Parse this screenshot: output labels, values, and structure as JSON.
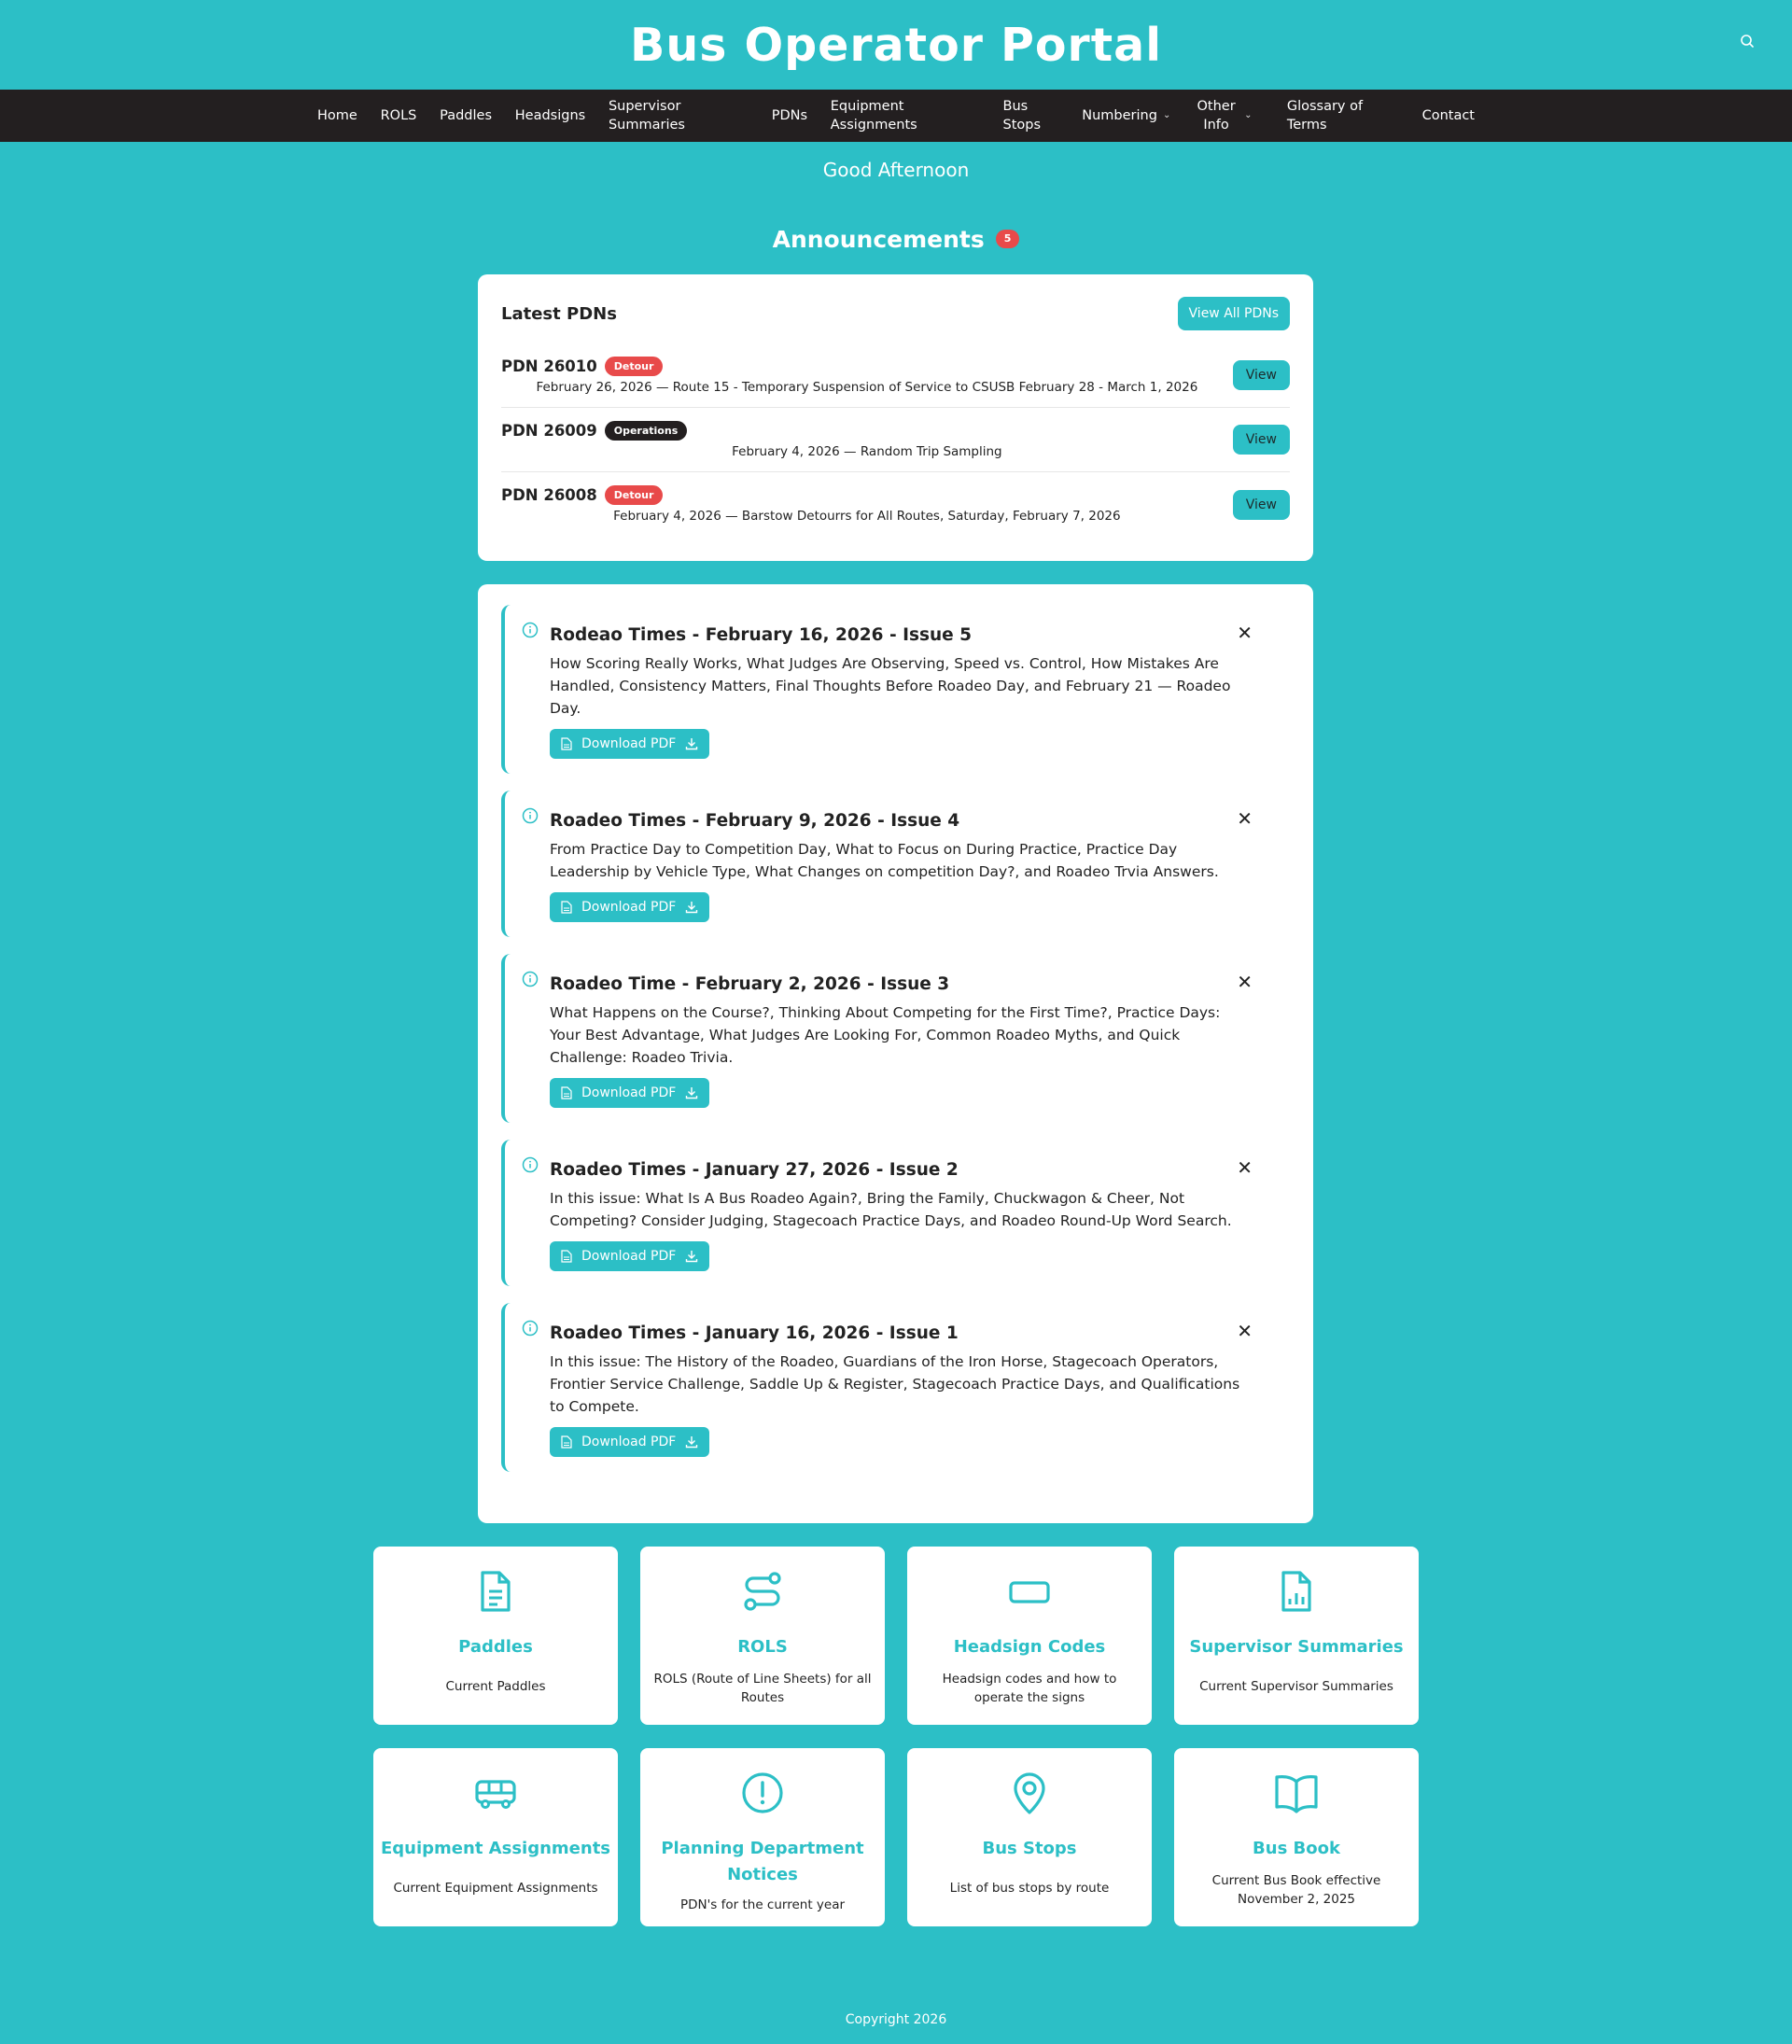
{
  "header": {
    "title": "Bus Operator Portal"
  },
  "nav": {
    "items": [
      {
        "label": "Home"
      },
      {
        "label": "ROLS"
      },
      {
        "label": "Paddles"
      },
      {
        "label": "Headsigns"
      },
      {
        "label": "Supervisor Summaries"
      },
      {
        "label": "PDNs"
      },
      {
        "label": "Equipment Assignments"
      },
      {
        "label": "Bus Stops"
      },
      {
        "label": "Numbering"
      },
      {
        "label": "Other Info"
      },
      {
        "label": "Glossary of Terms"
      },
      {
        "label": "Contact"
      }
    ]
  },
  "greeting": "Good Afternoon",
  "announcements": {
    "heading": "Announcements",
    "count": "5"
  },
  "pdns": {
    "heading": "Latest PDNs",
    "view_all_label": "View All PDNs",
    "view_label": "View",
    "rows": [
      {
        "number": "PDN 26010",
        "tag": "Detour",
        "desc": "February 26, 2026 — Route 15 - Temporary Suspension of Service to CSUSB February 28 - March 1, 2026"
      },
      {
        "number": "PDN 26009",
        "tag": "Operations",
        "desc": "February 4, 2026 — Random Trip Sampling"
      },
      {
        "number": "PDN 26008",
        "tag": "Detour",
        "desc": "February 4, 2026 — Barstow Detourrs for All Routes, Saturday, February 7, 2026"
      }
    ]
  },
  "newsletters": {
    "download_label": "Download PDF",
    "items": [
      {
        "title": "Rodeao Times - February 16, 2026 - Issue 5",
        "desc": "How Scoring Really Works, What Judges Are Observing, Speed vs. Control, How Mistakes Are Handled, Consistency Matters, Final Thoughts Before Roadeo Day, and February 21 — Roadeo Day."
      },
      {
        "title": "Roadeo Times - February 9, 2026 - Issue 4",
        "desc": "From Practice Day to Competition Day, What to Focus on During Practice, Practice Day Leadership by Vehicle Type, What Changes on competition Day?, and Roadeo Trvia Answers."
      },
      {
        "title": "Roadeo Time - February 2, 2026 - Issue 3",
        "desc": "What Happens on the Course?, Thinking About Competing for the First Time?, Practice Days: Your Best Advantage, What Judges Are Looking For, Common Roadeo Myths, and Quick Challenge: Roadeo Trivia."
      },
      {
        "title": "Roadeo Times - January 27, 2026 - Issue 2",
        "desc": "In this issue: What Is A Bus Roadeo Again?, Bring the Family, Chuckwagon & Cheer, Not Competing? Consider Judging, Stagecoach Practice Days, and Roadeo Round-Up Word Search."
      },
      {
        "title": "Roadeo Times - January 16, 2026 - Issue 1",
        "desc": "In this issue: The History of the Roadeo, Guardians of the Iron Horse, Stagecoach Operators, Frontier Service Challenge, Saddle Up & Register, Stagecoach Practice Days, and Qualifications to Compete."
      }
    ]
  },
  "tiles": [
    {
      "icon": "document-icon",
      "title": "Paddles",
      "desc": "Current Paddles"
    },
    {
      "icon": "route-icon",
      "title": "ROLS",
      "desc": "ROLS (Route of Line Sheets) for all Routes"
    },
    {
      "icon": "rectangle-icon",
      "title": "Headsign Codes",
      "desc": "Headsign codes and how to operate the signs"
    },
    {
      "icon": "chart-document-icon",
      "title": "Supervisor Summaries",
      "desc": "Current Supervisor Summaries"
    },
    {
      "icon": "bus-icon",
      "title": "Equipment Assignments",
      "desc": "Current Equipment Assignments"
    },
    {
      "icon": "alert-circle-icon",
      "title": "Planning Department Notices",
      "desc": "PDN's for the current year"
    },
    {
      "icon": "map-pin-icon",
      "title": "Bus Stops",
      "desc": "List of bus stops by route"
    },
    {
      "icon": "book-icon",
      "title": "Bus Book",
      "desc": "Current Bus Book effective November 2, 2025"
    }
  ],
  "footer": {
    "copyright": "Copyright 2026"
  },
  "colors": {
    "accent": "#2cbfc6",
    "nav": "#231f20",
    "detour": "#e84a4a"
  }
}
